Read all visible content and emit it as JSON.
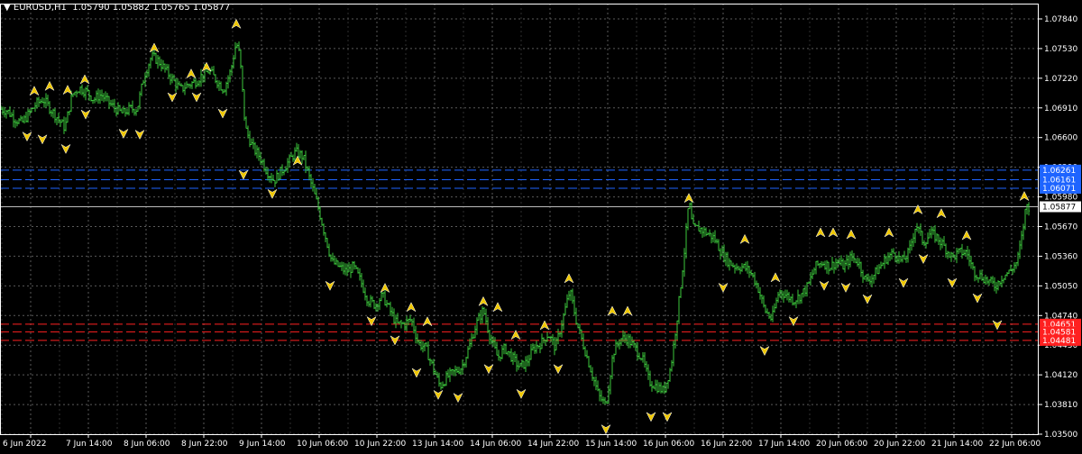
{
  "header": {
    "menu_glyph": "▼",
    "symbol_timeframe": "EURUSD,H1",
    "ohlc": "1.05790 1.05882 1.05765 1.05877"
  },
  "colors": {
    "background": "#000000",
    "grid": "#5a5a5a",
    "axis": "#ffffff",
    "bars": "#3cc83c",
    "fractal": "#f0c800",
    "resistance": "#1e64ff",
    "support": "#ff2020",
    "price_tag_bg": "#ffffff"
  },
  "chart_data": {
    "type": "bar",
    "symbol": "EURUSD",
    "timeframe": "H1",
    "ylim": [
      1.035,
      1.08
    ],
    "y_ticks": [
      "1.07840",
      "1.07530",
      "1.07220",
      "1.06910",
      "1.06600",
      "1.06290",
      "1.05980",
      "1.05670",
      "1.05360",
      "1.05050",
      "1.04740",
      "1.04430",
      "1.04120",
      "1.03810",
      "1.03500"
    ],
    "x_ticks": [
      "6 Jun 2022",
      "7 Jun 14:00",
      "8 Jun 06:00",
      "8 Jun 22:00",
      "9 Jun 14:00",
      "10 Jun 06:00",
      "10 Jun 22:00",
      "13 Jun 14:00",
      "14 Jun 06:00",
      "14 Jun 22:00",
      "15 Jun 14:00",
      "16 Jun 06:00",
      "16 Jun 22:00",
      "17 Jun 14:00",
      "20 Jun 06:00",
      "20 Jun 22:00",
      "21 Jun 14:00",
      "22 Jun 06:00"
    ],
    "current_price": "1.05877",
    "resistance_levels": [
      {
        "price": 1.0626,
        "label": "1.06261"
      },
      {
        "price": 1.0616,
        "label": "1.06161"
      },
      {
        "price": 1.0607,
        "label": "1.06071"
      }
    ],
    "support_levels": [
      {
        "price": 1.0465,
        "label": "1.04651"
      },
      {
        "price": 1.0457,
        "label": "1.04581"
      },
      {
        "price": 1.0448,
        "label": "1.04481"
      }
    ],
    "price_path": [
      [
        0,
        1.069
      ],
      [
        8,
        1.0688
      ],
      [
        16,
        1.068
      ],
      [
        24,
        1.0675
      ],
      [
        32,
        1.0685
      ],
      [
        40,
        1.0695
      ],
      [
        48,
        1.07
      ],
      [
        56,
        1.069
      ],
      [
        64,
        1.068
      ],
      [
        72,
        1.067
      ],
      [
        80,
        1.0705
      ],
      [
        88,
        1.0712
      ],
      [
        96,
        1.0708
      ],
      [
        104,
        1.07
      ],
      [
        112,
        1.0705
      ],
      [
        120,
        1.0697
      ],
      [
        128,
        1.069
      ],
      [
        136,
        1.0685
      ],
      [
        144,
        1.069
      ],
      [
        152,
        1.069
      ],
      [
        160,
        1.0725
      ],
      [
        168,
        1.0745
      ],
      [
        176,
        1.074
      ],
      [
        184,
        1.073
      ],
      [
        192,
        1.072
      ],
      [
        200,
        1.071
      ],
      [
        208,
        1.0715
      ],
      [
        216,
        1.0718
      ],
      [
        224,
        1.0725
      ],
      [
        232,
        1.073
      ],
      [
        240,
        1.072
      ],
      [
        248,
        1.071
      ],
      [
        256,
        1.073
      ],
      [
        262,
        1.076
      ],
      [
        266,
        1.0745
      ],
      [
        272,
        1.067
      ],
      [
        280,
        1.065
      ],
      [
        288,
        1.064
      ],
      [
        296,
        1.0625
      ],
      [
        304,
        1.0615
      ],
      [
        312,
        1.0625
      ],
      [
        320,
        1.0635
      ],
      [
        328,
        1.0645
      ],
      [
        336,
        1.064
      ],
      [
        344,
        1.0615
      ],
      [
        352,
        1.059
      ],
      [
        360,
        1.056
      ],
      [
        368,
        1.053
      ],
      [
        376,
        1.0525
      ],
      [
        384,
        1.052
      ],
      [
        392,
        1.0525
      ],
      [
        400,
        1.051
      ],
      [
        408,
        1.049
      ],
      [
        416,
        1.0485
      ],
      [
        424,
        1.0495
      ],
      [
        432,
        1.048
      ],
      [
        440,
        1.0465
      ],
      [
        448,
        1.0465
      ],
      [
        456,
        1.047
      ],
      [
        464,
        1.0445
      ],
      [
        472,
        1.044
      ],
      [
        480,
        1.042
      ],
      [
        488,
        1.04
      ],
      [
        496,
        1.041
      ],
      [
        504,
        1.0415
      ],
      [
        512,
        1.042
      ],
      [
        520,
        1.044
      ],
      [
        528,
        1.0465
      ],
      [
        536,
        1.048
      ],
      [
        544,
        1.045
      ],
      [
        552,
        1.043
      ],
      [
        560,
        1.044
      ],
      [
        568,
        1.043
      ],
      [
        576,
        1.042
      ],
      [
        584,
        1.0425
      ],
      [
        592,
        1.044
      ],
      [
        600,
        1.0445
      ],
      [
        608,
        1.0455
      ],
      [
        616,
        1.044
      ],
      [
        624,
        1.047
      ],
      [
        632,
        1.05
      ],
      [
        640,
        1.0465
      ],
      [
        648,
        1.044
      ],
      [
        656,
        1.0415
      ],
      [
        664,
        1.039
      ],
      [
        672,
        1.038
      ],
      [
        680,
        1.0435
      ],
      [
        688,
        1.045
      ],
      [
        696,
        1.045
      ],
      [
        704,
        1.044
      ],
      [
        712,
        1.043
      ],
      [
        720,
        1.0405
      ],
      [
        728,
        1.04
      ],
      [
        736,
        1.0395
      ],
      [
        744,
        1.042
      ],
      [
        752,
        1.048
      ],
      [
        760,
        1.055
      ],
      [
        764,
        1.0595
      ],
      [
        768,
        1.0565
      ],
      [
        776,
        1.0565
      ],
      [
        784,
        1.056
      ],
      [
        792,
        1.0555
      ],
      [
        800,
        1.054
      ],
      [
        808,
        1.053
      ],
      [
        816,
        1.0525
      ],
      [
        824,
        1.0525
      ],
      [
        832,
        1.052
      ],
      [
        840,
        1.0505
      ],
      [
        848,
        1.048
      ],
      [
        856,
        1.047
      ],
      [
        864,
        1.05
      ],
      [
        872,
        1.0495
      ],
      [
        880,
        1.049
      ],
      [
        888,
        1.0495
      ],
      [
        896,
        1.0505
      ],
      [
        904,
        1.0525
      ],
      [
        912,
        1.053
      ],
      [
        920,
        1.0525
      ],
      [
        928,
        1.053
      ],
      [
        936,
        1.0525
      ],
      [
        944,
        1.0535
      ],
      [
        952,
        1.053
      ],
      [
        960,
        1.051
      ],
      [
        968,
        1.0515
      ],
      [
        976,
        1.0525
      ],
      [
        984,
        1.0535
      ],
      [
        992,
        1.054
      ],
      [
        1000,
        1.053
      ],
      [
        1008,
        1.054
      ],
      [
        1016,
        1.057
      ],
      [
        1024,
        1.055
      ],
      [
        1032,
        1.056
      ],
      [
        1040,
        1.0555
      ],
      [
        1048,
        1.0545
      ],
      [
        1056,
        1.0535
      ],
      [
        1064,
        1.054
      ],
      [
        1072,
        1.054
      ],
      [
        1080,
        1.052
      ],
      [
        1088,
        1.0515
      ],
      [
        1096,
        1.051
      ],
      [
        1104,
        1.0505
      ],
      [
        1112,
        1.0515
      ],
      [
        1120,
        1.052
      ],
      [
        1128,
        1.053
      ],
      [
        1134,
        1.056
      ],
      [
        1138,
        1.059
      ],
      [
        1142,
        1.0587
      ]
    ],
    "fractals_up": [
      [
        38,
        1.0708
      ],
      [
        55,
        1.0713
      ],
      [
        75,
        1.0709
      ],
      [
        94,
        1.072
      ],
      [
        171,
        1.0753
      ],
      [
        212,
        1.0726
      ],
      [
        229,
        1.0733
      ],
      [
        262,
        1.0778
      ],
      [
        330,
        1.0635
      ],
      [
        427,
        1.0502
      ],
      [
        456,
        1.0482
      ],
      [
        474,
        1.0467
      ],
      [
        536,
        1.0488
      ],
      [
        552,
        1.0482
      ],
      [
        572,
        1.0453
      ],
      [
        604,
        1.0463
      ],
      [
        631,
        1.0512
      ],
      [
        679,
        1.0478
      ],
      [
        696,
        1.0478
      ],
      [
        764,
        1.0596
      ],
      [
        826,
        1.0553
      ],
      [
        860,
        1.0513
      ],
      [
        910,
        1.056
      ],
      [
        924,
        1.056
      ],
      [
        944,
        1.0558
      ],
      [
        986,
        1.056
      ],
      [
        1018,
        1.0584
      ],
      [
        1044,
        1.058
      ],
      [
        1072,
        1.0557
      ],
      [
        1136,
        1.0598
      ]
    ],
    "fractals_down": [
      [
        30,
        1.0662
      ],
      [
        47,
        1.0659
      ],
      [
        73,
        1.0649
      ],
      [
        95,
        1.0685
      ],
      [
        137,
        1.0665
      ],
      [
        155,
        1.0664
      ],
      [
        191,
        1.0703
      ],
      [
        218,
        1.0703
      ],
      [
        247,
        1.0686
      ],
      [
        270,
        1.0622
      ],
      [
        302,
        1.0602
      ],
      [
        366,
        1.0506
      ],
      [
        412,
        1.0469
      ],
      [
        438,
        1.0449
      ],
      [
        462,
        1.0415
      ],
      [
        486,
        1.0392
      ],
      [
        508,
        1.0389
      ],
      [
        542,
        1.0419
      ],
      [
        578,
        1.0393
      ],
      [
        619,
        1.0419
      ],
      [
        672,
        1.0356
      ],
      [
        722,
        1.0369
      ],
      [
        740,
        1.0369
      ],
      [
        802,
        1.0504
      ],
      [
        848,
        1.0438
      ],
      [
        880,
        1.0469
      ],
      [
        914,
        1.0506
      ],
      [
        938,
        1.0504
      ],
      [
        962,
        1.0492
      ],
      [
        1002,
        1.0509
      ],
      [
        1024,
        1.0534
      ],
      [
        1056,
        1.0509
      ],
      [
        1084,
        1.0493
      ],
      [
        1106,
        1.0465
      ]
    ]
  }
}
